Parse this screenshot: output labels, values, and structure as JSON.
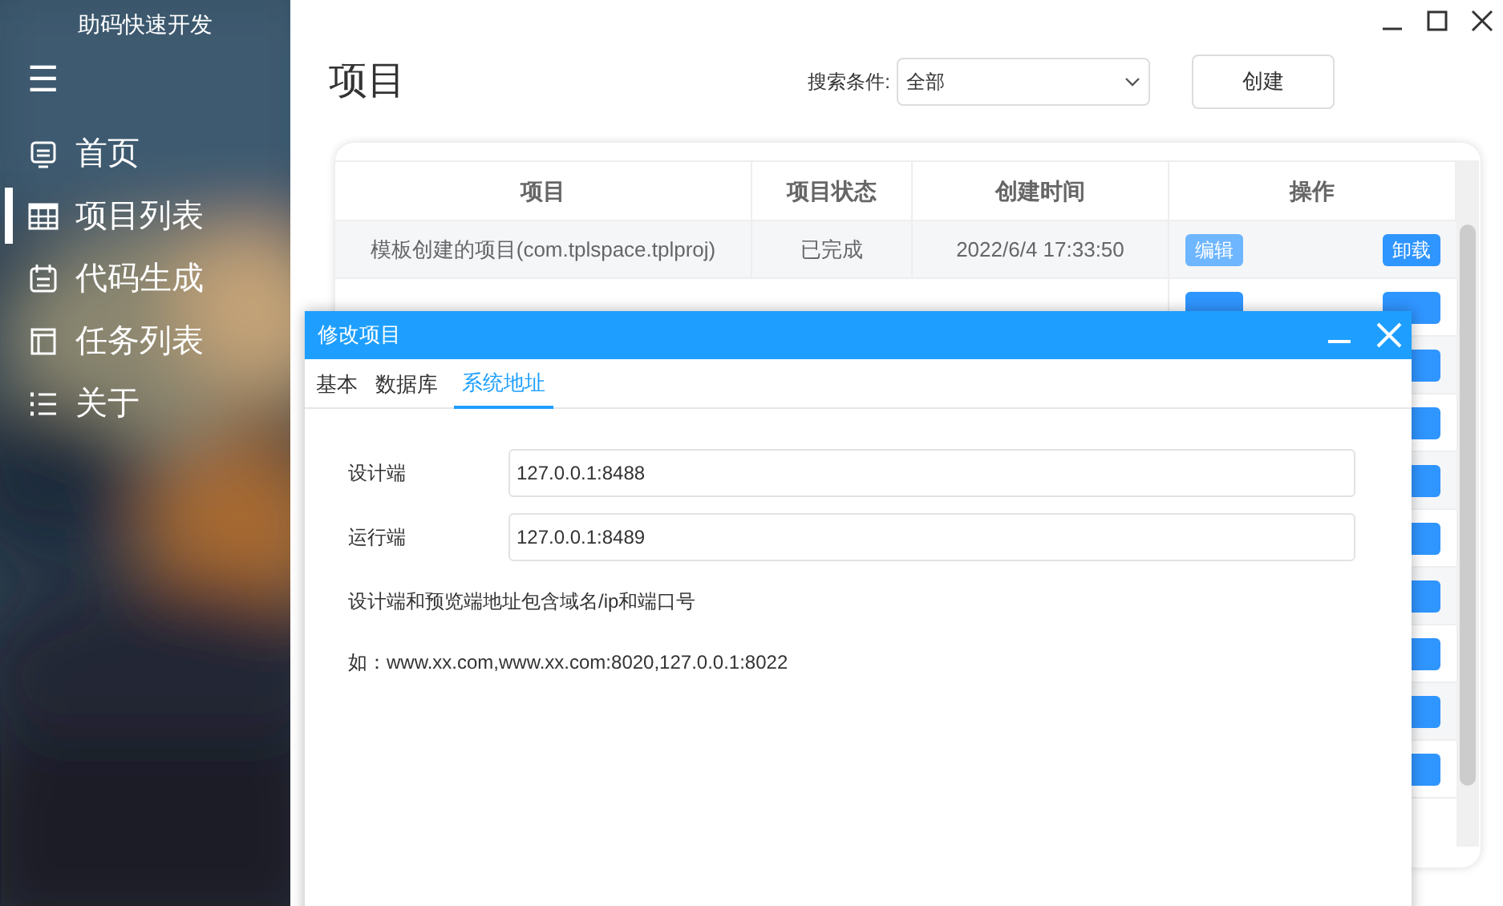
{
  "sidebar": {
    "title": "助码快速开发",
    "menu_icon": "☰",
    "items": [
      {
        "label": "首页",
        "selected": false
      },
      {
        "label": "项目列表",
        "selected": true
      },
      {
        "label": "代码生成",
        "selected": false
      },
      {
        "label": "任务列表",
        "selected": false
      },
      {
        "label": "关于",
        "selected": false
      }
    ]
  },
  "page": {
    "title": "项目",
    "search_label": "搜索条件:",
    "search_value": "全部",
    "create_button": "创建"
  },
  "table": {
    "columns": [
      "项目",
      "项目状态",
      "创建时间",
      "操作"
    ],
    "rows": [
      {
        "kind": "full",
        "project": "模板创建的项目(com.tplspace.tplproj)",
        "status": "已完成",
        "created": "2022/6/4 17:33:50",
        "edit": "编辑",
        "uninstall": "卸载"
      },
      {
        "kind": "partial"
      },
      {
        "kind": "covered"
      },
      {
        "kind": "covered"
      },
      {
        "kind": "covered"
      },
      {
        "kind": "covered"
      },
      {
        "kind": "covered"
      },
      {
        "kind": "covered"
      },
      {
        "kind": "covered"
      },
      {
        "kind": "covered"
      }
    ]
  },
  "dialog": {
    "title": "修改项目",
    "tabs": [
      {
        "label": "基本",
        "selected": false
      },
      {
        "label": "数据库",
        "selected": false
      },
      {
        "label": "系统地址",
        "selected": true
      }
    ],
    "fields": [
      {
        "label": "设计端",
        "value": "127.0.0.1:8488"
      },
      {
        "label": "运行端",
        "value": "127.0.0.1:8489"
      }
    ],
    "notes": [
      "设计端和预览端地址包含域名/ip和端口号",
      "如：www.xx.com,www.xx.com:8020,127.0.0.1:8022"
    ]
  }
}
